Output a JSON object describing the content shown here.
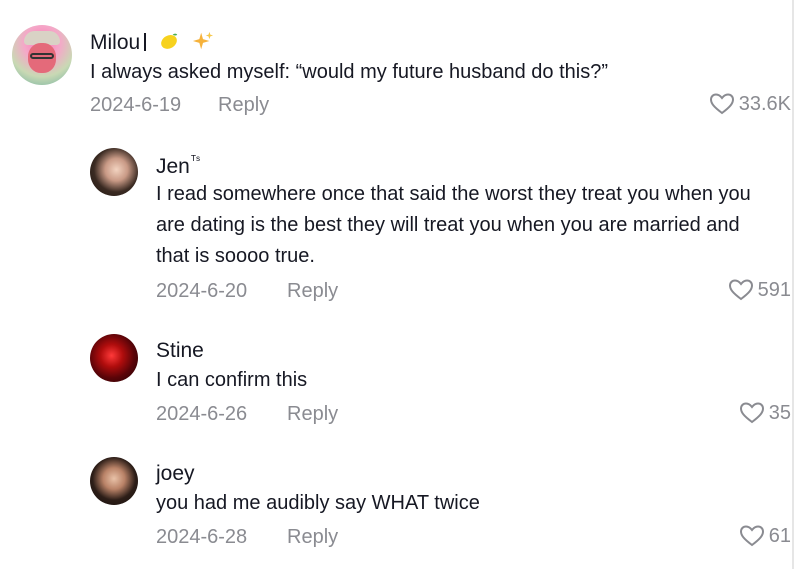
{
  "comments": [
    {
      "username": "Milou",
      "username_suffix_emoji": [
        "lemon",
        "sparkles"
      ],
      "text": "I always asked myself: “would my future husband do this?”",
      "date": "2024-6-19",
      "reply_label": "Reply",
      "likes": "33.6K"
    }
  ],
  "replies": [
    {
      "username": "Jen",
      "username_tag": "ᵀˢ",
      "text": "I read somewhere once that said the worst they treat you when you are dating is the best they will treat you when you are married and that is soooo true.",
      "date": "2024-6-20",
      "reply_label": "Reply",
      "likes": "591"
    },
    {
      "username": "Stine",
      "text": "I can confirm this",
      "date": "2024-6-26",
      "reply_label": "Reply",
      "likes": "35"
    },
    {
      "username": "joey",
      "text": "you had me audibly say WHAT twice",
      "date": "2024-6-28",
      "reply_label": "Reply",
      "likes": "61"
    }
  ],
  "icons": {
    "like": "heart-outline-icon"
  },
  "colors": {
    "text_primary": "#161823",
    "text_secondary": "#8a8b91",
    "background": "#ffffff"
  }
}
